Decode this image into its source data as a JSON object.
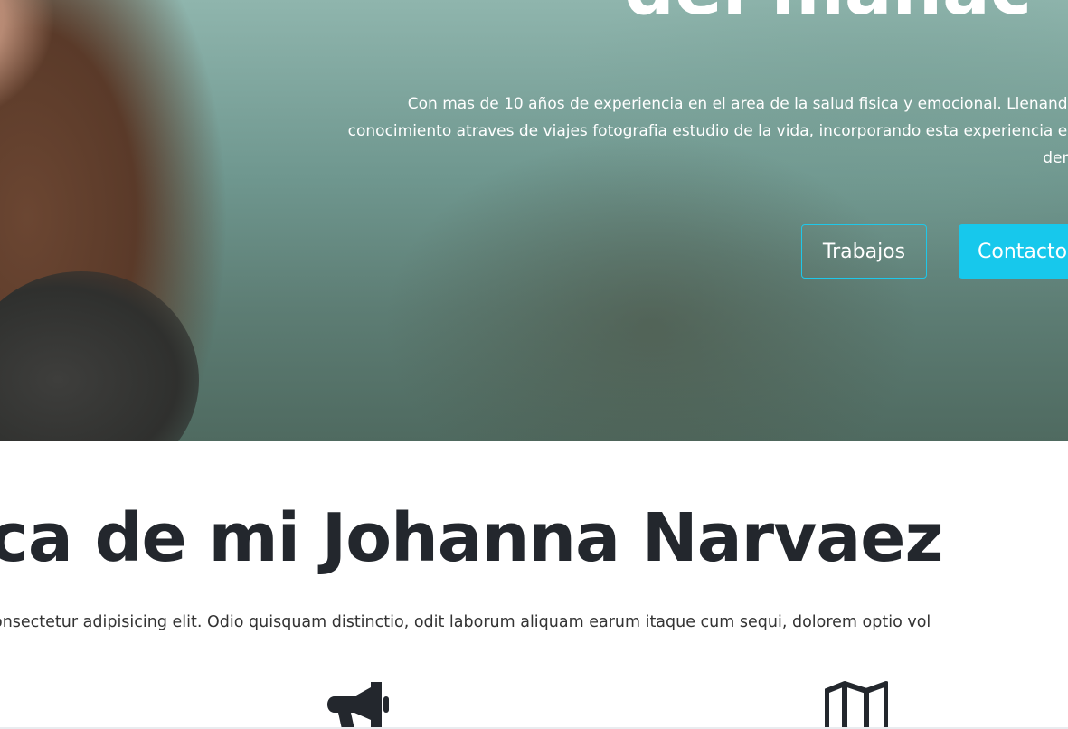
{
  "hero": {
    "title": "del manac",
    "paragraph_lines": [
      "Con mas de 10 años de experiencia en el area de la salud fisica y emocional. Llenando",
      "conocimiento atraves de viajes fotografia estudio de la vida, incorporando esta experiencia en",
      "dem"
    ],
    "buttons": {
      "works_label": "Trabajos",
      "contact_label": "Contacto"
    },
    "accent_color": "#17c8ec"
  },
  "about": {
    "title": "ca de mi Johanna Narvaez",
    "text": "onsectetur adipisicing elit. Odio quisquam distinctio, odit laborum aliquam earum itaque cum sequi, dolorem optio vol",
    "icons": [
      "megaphone-icon",
      "map-icon"
    ]
  }
}
